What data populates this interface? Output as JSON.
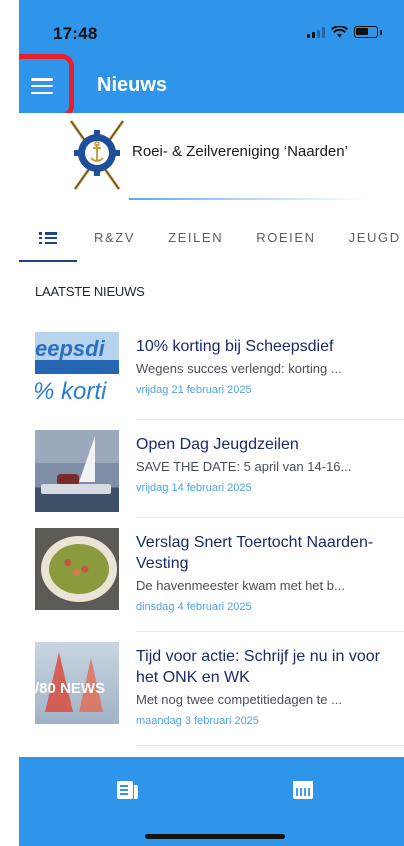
{
  "status_bar": {
    "time": "17:48"
  },
  "app_bar": {
    "title": "Nieuws",
    "menu_icon": "hamburger-menu-icon"
  },
  "banner": {
    "club_name": "Roei- & Zeilvereniging ‘Naarden’"
  },
  "tabs": [
    {
      "label": "R&ZV"
    },
    {
      "label": "ZEILEN"
    },
    {
      "label": "ROEIEN"
    },
    {
      "label": "JEUGD"
    }
  ],
  "section": {
    "label": "LAATSTE NIEUWS"
  },
  "news": [
    {
      "title": "10% korting bij Scheepsdief",
      "excerpt": "Wegens succes verlengd: korting ...",
      "date": "vrijdag 21 februari 2025",
      "thumb_text_top": "eepsdi",
      "thumb_text_bottom": "% korti"
    },
    {
      "title": "Open Dag Jeugdzeilen",
      "excerpt": "SAVE THE DATE: 5 april van 14-16...",
      "date": "vrijdag 14 februari 2025"
    },
    {
      "title": "Verslag Snert Toertocht Naarden-Vesting",
      "excerpt": "De havenmeester kwam met het b...",
      "date": "dinsdag 4 februari 2025"
    },
    {
      "title": "Tijd voor actie: Schrijf je nu in voor het ONK en WK",
      "excerpt": "Met nog twee competitiedagen te ...",
      "date": "maandag 3 februari 2025",
      "thumb_text": "/80 NEWS"
    }
  ],
  "bottom_nav": [
    {
      "icon": "newspaper-icon"
    },
    {
      "icon": "calendar-icon"
    }
  ],
  "colors": {
    "primary": "#2f95ea",
    "highlight": "#e8202a",
    "title_text": "#1a2a6b",
    "date_text": "#4da3e6"
  }
}
